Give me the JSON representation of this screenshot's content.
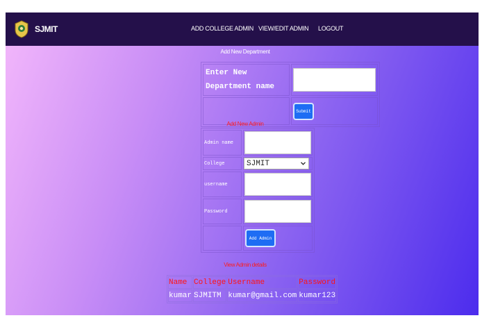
{
  "navbar": {
    "brand": "SJMIT",
    "links": [
      "ADD COLLEGE ADMIN",
      "VIEW/EDIT ADMIN",
      "LOGOUT"
    ]
  },
  "department": {
    "title": "Add New Department",
    "label": "Enter New Department name",
    "input_value": "",
    "submit_label": "Submit"
  },
  "admin_form": {
    "title": "Add New Admin",
    "fields": {
      "admin_name": {
        "label": "Admin name",
        "value": ""
      },
      "college": {
        "label": "College",
        "selected": "SJMIT"
      },
      "username": {
        "label": "username",
        "value": ""
      },
      "password": {
        "label": "Password",
        "value": ""
      }
    },
    "submit_label": "Add Admin"
  },
  "admin_details": {
    "title": "View Admin details",
    "headers": [
      "Name",
      "College",
      "Username",
      "Password"
    ],
    "rows": [
      [
        "kumar",
        "SJMITM",
        "kumar@gmail.com",
        "kumar123"
      ]
    ]
  },
  "colors": {
    "navbar": "#24104a",
    "button": "#1e6df4",
    "accent_red": "#ff1414",
    "gradient_start": "#f4b8fb",
    "gradient_end": "#4c2ced"
  }
}
